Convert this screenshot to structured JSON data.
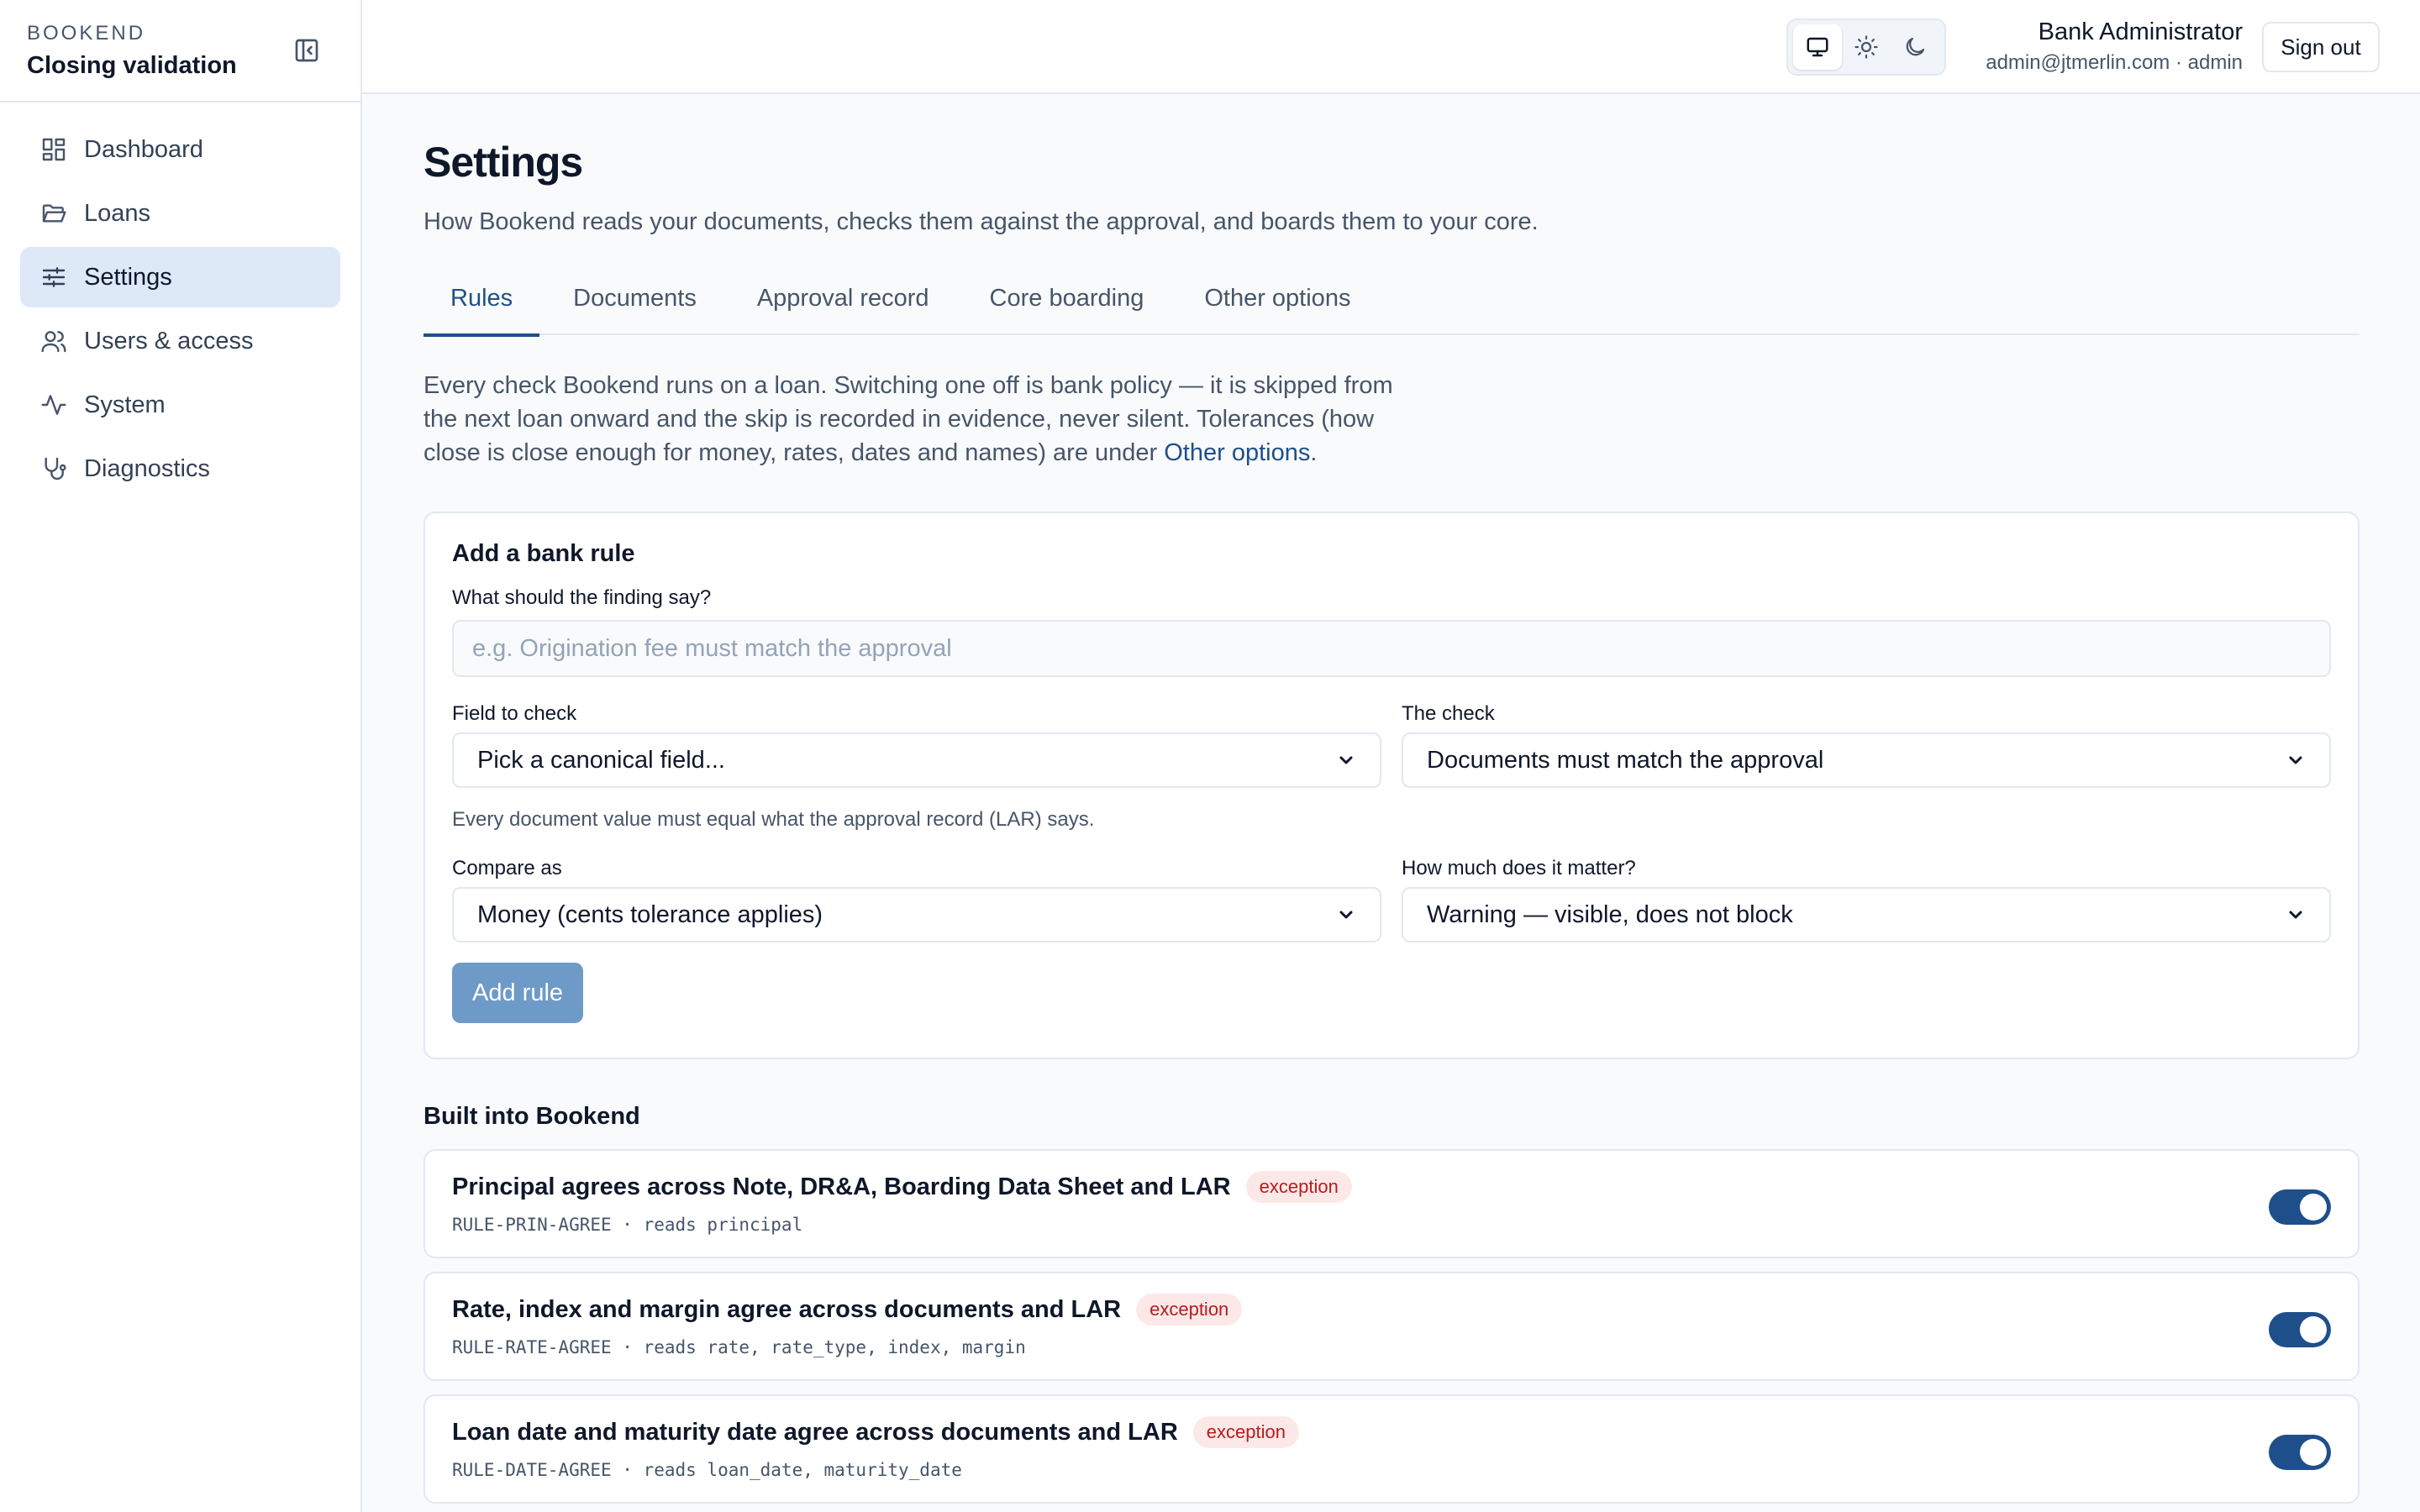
{
  "brand": {
    "small": "BOOKEND",
    "title": "Closing validation"
  },
  "sidebar": {
    "items": [
      {
        "label": "Dashboard",
        "icon": "dashboard-icon"
      },
      {
        "label": "Loans",
        "icon": "folder-icon"
      },
      {
        "label": "Settings",
        "icon": "sliders-icon",
        "active": true
      },
      {
        "label": "Users & access",
        "icon": "users-icon"
      },
      {
        "label": "System",
        "icon": "activity-icon"
      },
      {
        "label": "Diagnostics",
        "icon": "stethoscope-icon"
      }
    ]
  },
  "header": {
    "user_name": "Bank Administrator",
    "user_sub": "admin@jtmerlin.com · admin",
    "sign_out": "Sign out",
    "theme_options": [
      "system",
      "light",
      "dark"
    ]
  },
  "page": {
    "title": "Settings",
    "subtitle": "How Bookend reads your documents, checks them against the approval, and boards them to your core."
  },
  "tabs": [
    {
      "label": "Rules",
      "active": true
    },
    {
      "label": "Documents"
    },
    {
      "label": "Approval record"
    },
    {
      "label": "Core boarding"
    },
    {
      "label": "Other options"
    }
  ],
  "intro": {
    "text": "Every check Bookend runs on a loan. Switching one off is bank policy — it is skipped from the next loan onward and the skip is recorded in evidence, never silent. Tolerances (how close is close enough for money, rates, dates and names) are under ",
    "link": "Other options",
    "suffix": "."
  },
  "add_rule": {
    "title": "Add a bank rule",
    "finding_label": "What should the finding say?",
    "finding_placeholder": "e.g. Origination fee must match the approval",
    "field_label": "Field to check",
    "field_value": "Pick a canonical field...",
    "check_label": "The check",
    "check_value": "Documents must match the approval",
    "check_hint": "Every document value must equal what the approval record (LAR) says.",
    "compare_label": "Compare as",
    "compare_value": "Money (cents tolerance applies)",
    "severity_label": "How much does it matter?",
    "severity_value": "Warning — visible, does not block",
    "button": "Add rule"
  },
  "built_in": {
    "title": "Built into Bookend",
    "rules": [
      {
        "title": "Principal agrees across Note, DR&A, Boarding Data Sheet and LAR",
        "badge": "exception",
        "meta": "RULE-PRIN-AGREE · reads principal",
        "enabled": true
      },
      {
        "title": "Rate, index and margin agree across documents and LAR",
        "badge": "exception",
        "meta": "RULE-RATE-AGREE · reads rate, rate_type, index, margin",
        "enabled": true
      },
      {
        "title": "Loan date and maturity date agree across documents and LAR",
        "badge": "exception",
        "meta": "RULE-DATE-AGREE · reads loan_date, maturity_date",
        "enabled": true
      }
    ]
  },
  "colors": {
    "accent": "#1e4f8a",
    "active_nav": "#dde9f7",
    "badge_text": "#b91c1c",
    "badge_bg": "#fde8e8",
    "button_disabled": "#6e9ac8"
  }
}
